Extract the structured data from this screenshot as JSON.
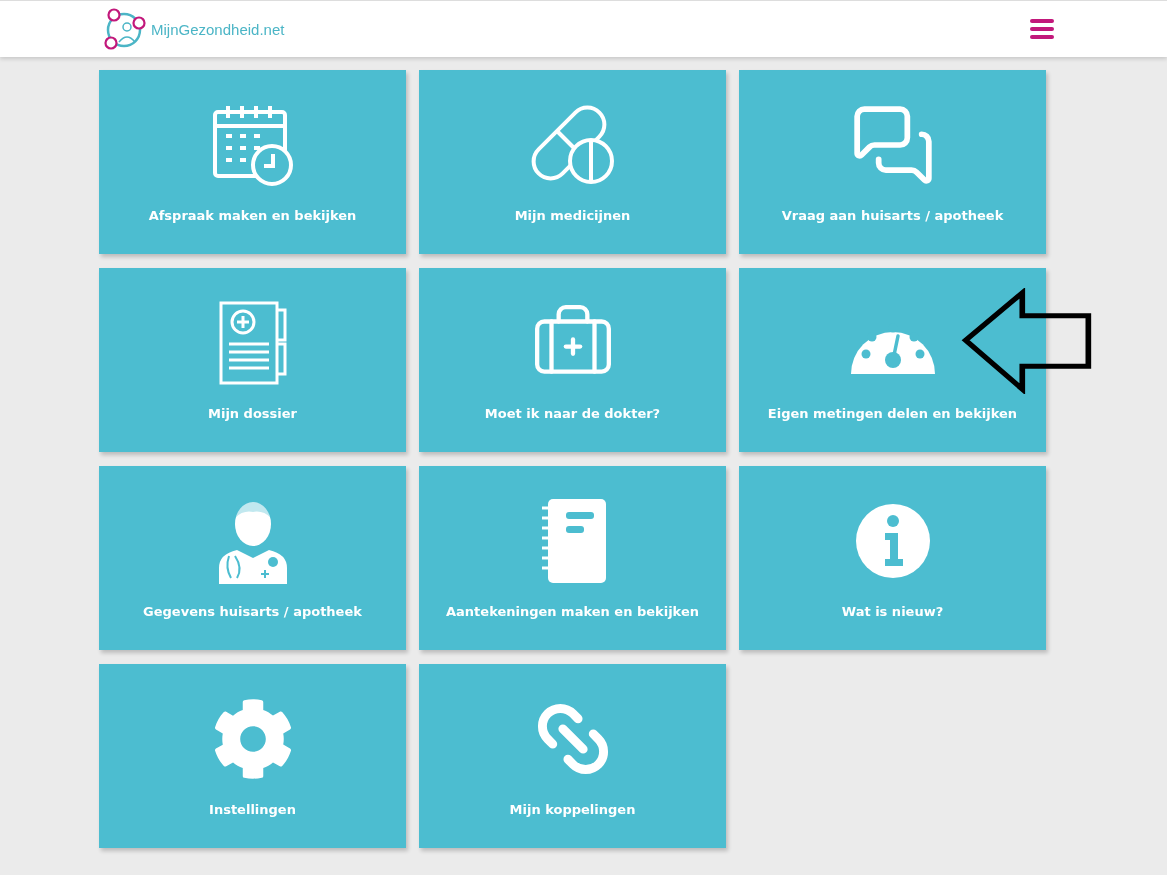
{
  "header": {
    "logo_text": "MijnGezondheid.net"
  },
  "tiles": [
    {
      "kind": "calendar",
      "label": "Afspraak maken en bekijken"
    },
    {
      "kind": "pills",
      "label": "Mijn medicijnen"
    },
    {
      "kind": "question",
      "label": "Vraag aan huisarts / apotheek"
    },
    {
      "kind": "dossier",
      "label": "Mijn dossier"
    },
    {
      "kind": "medkit",
      "label": "Moet ik naar de dokter?"
    },
    {
      "kind": "gauge",
      "label": "Eigen metingen delen en bekijken"
    },
    {
      "kind": "doctor",
      "label": "Gegevens huisarts / apotheek"
    },
    {
      "kind": "notebook",
      "label": "Aantekeningen maken en bekijken"
    },
    {
      "kind": "info",
      "label": "Wat is nieuw?"
    },
    {
      "kind": "gear",
      "label": "Instellingen"
    },
    {
      "kind": "link",
      "label": "Mijn koppelingen"
    }
  ]
}
